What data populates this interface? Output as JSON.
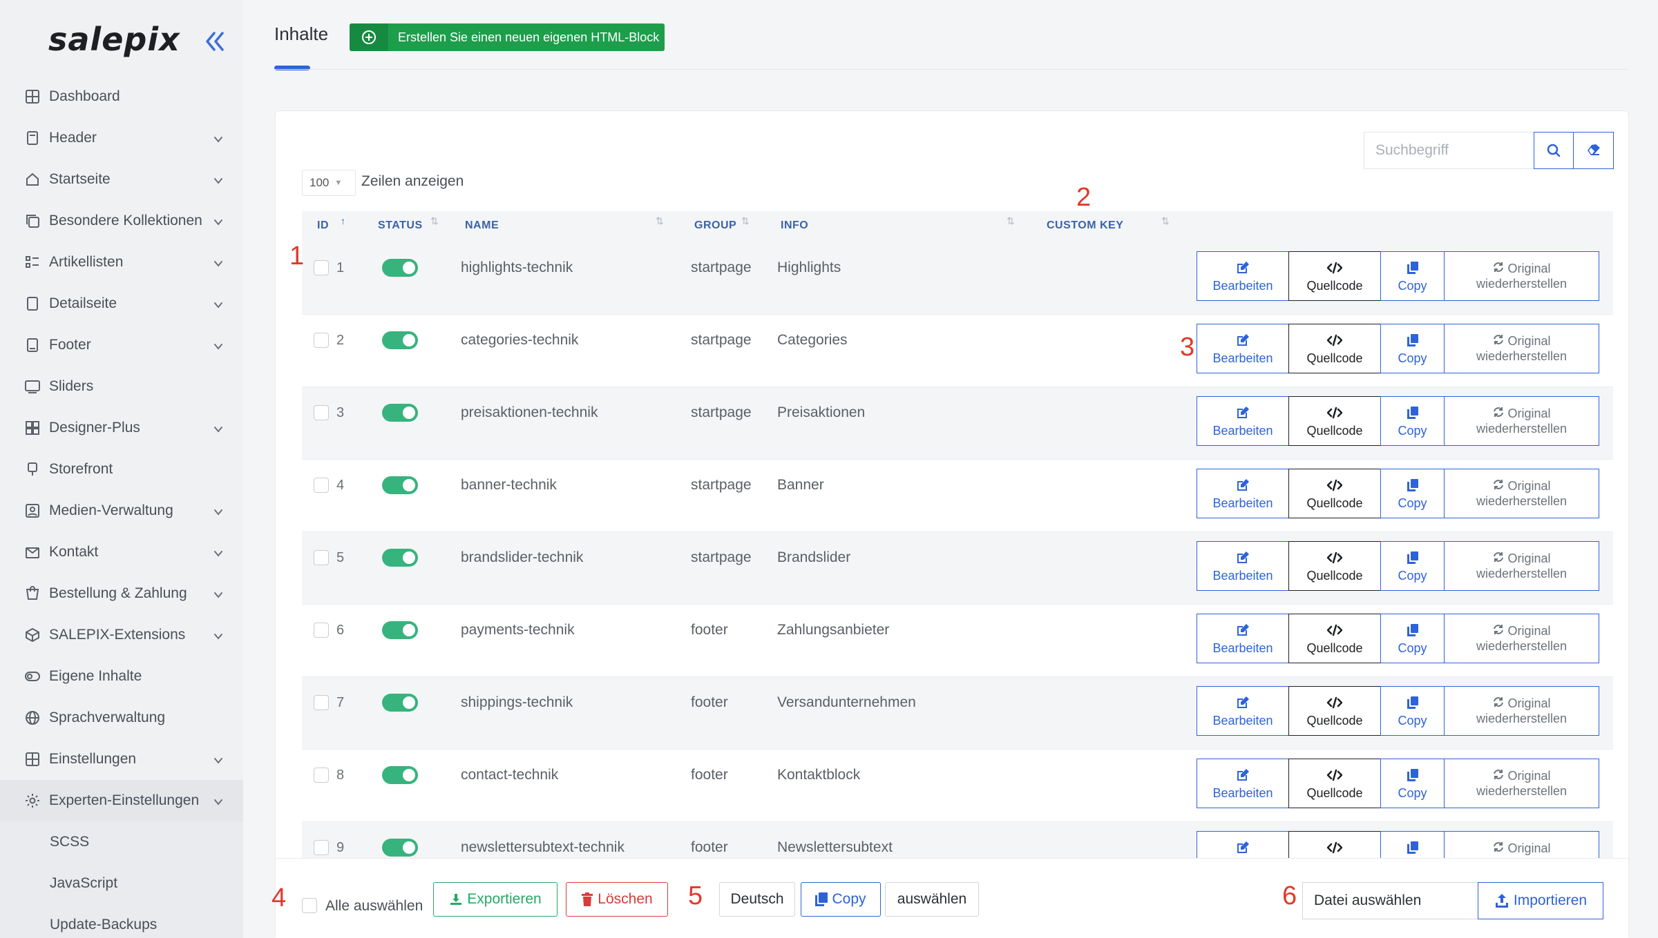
{
  "app": {
    "logo": "salepix"
  },
  "sidebar": {
    "items": [
      {
        "label": "Dashboard",
        "icon": "dashboard-icon",
        "chevron": false
      },
      {
        "label": "Header",
        "icon": "header-icon",
        "chevron": true
      },
      {
        "label": "Startseite",
        "icon": "home-icon",
        "chevron": true
      },
      {
        "label": "Besondere Kollektionen",
        "icon": "collection-icon",
        "chevron": true
      },
      {
        "label": "Artikellisten",
        "icon": "list-icon",
        "chevron": true
      },
      {
        "label": "Detailseite",
        "icon": "page-icon",
        "chevron": true
      },
      {
        "label": "Footer",
        "icon": "footer-icon",
        "chevron": true
      },
      {
        "label": "Sliders",
        "icon": "slider-icon",
        "chevron": false
      },
      {
        "label": "Designer-Plus",
        "icon": "designer-icon",
        "chevron": true
      },
      {
        "label": "Storefront",
        "icon": "storefront-icon",
        "chevron": false
      },
      {
        "label": "Medien-Verwaltung",
        "icon": "media-icon",
        "chevron": true
      },
      {
        "label": "Kontakt",
        "icon": "mail-icon",
        "chevron": true
      },
      {
        "label": "Bestellung & Zahlung",
        "icon": "cart-icon",
        "chevron": true
      },
      {
        "label": "SALEPIX-Extensions",
        "icon": "box-icon",
        "chevron": true
      },
      {
        "label": "Eigene Inhalte",
        "icon": "toggle-icon",
        "chevron": false
      },
      {
        "label": "Sprachverwaltung",
        "icon": "globe-icon",
        "chevron": false
      },
      {
        "label": "Einstellungen",
        "icon": "settings-grid-icon",
        "chevron": true
      },
      {
        "label": "Experten-Einstellungen",
        "icon": "gear-icon",
        "chevron": true
      }
    ],
    "subitems": [
      "SCSS",
      "JavaScript",
      "Update-Backups"
    ]
  },
  "header": {
    "title": "Inhalte",
    "new_button": "Erstellen Sie einen neuen eigenen HTML-Block"
  },
  "search": {
    "placeholder": "Suchbegriff"
  },
  "table": {
    "rows_per_page": "100",
    "rows_label": "Zeilen anzeigen",
    "columns": [
      "ID",
      "STATUS",
      "NAME",
      "GROUP",
      "INFO",
      "CUSTOM KEY"
    ],
    "rows": [
      {
        "id": "1",
        "name": "highlights-technik",
        "group": "startpage",
        "info": "Highlights",
        "active": true
      },
      {
        "id": "2",
        "name": "categories-technik",
        "group": "startpage",
        "info": "Categories",
        "active": true
      },
      {
        "id": "3",
        "name": "preisaktionen-technik",
        "group": "startpage",
        "info": "Preisaktionen",
        "active": true
      },
      {
        "id": "4",
        "name": "banner-technik",
        "group": "startpage",
        "info": "Banner",
        "active": true
      },
      {
        "id": "5",
        "name": "brandslider-technik",
        "group": "startpage",
        "info": "Brandslider",
        "active": true
      },
      {
        "id": "6",
        "name": "payments-technik",
        "group": "footer",
        "info": "Zahlungsanbieter",
        "active": true
      },
      {
        "id": "7",
        "name": "shippings-technik",
        "group": "footer",
        "info": "Versandunternehmen",
        "active": true
      },
      {
        "id": "8",
        "name": "contact-technik",
        "group": "footer",
        "info": "Kontaktblock",
        "active": true
      },
      {
        "id": "9",
        "name": "newslettersubtext-technik",
        "group": "footer",
        "info": "Newslettersubtext",
        "active": true
      }
    ],
    "actions": {
      "edit": "Bearbeiten",
      "source": "Quellcode",
      "copy": "Copy",
      "restore_top": "Original",
      "restore_bottom": "wiederherstellen"
    }
  },
  "footer": {
    "select_all": "Alle auswählen",
    "export": "Exportieren",
    "delete": "Löschen",
    "language": "Deutsch",
    "copy": "Copy",
    "choose": "auswählen",
    "file_input": "Datei auswählen",
    "import": "Importieren"
  },
  "annotations": [
    "1",
    "2",
    "3",
    "4",
    "5",
    "6"
  ],
  "colors": {
    "accent": "#2d63d8",
    "success": "#1c9e4b",
    "danger": "#d93b3b",
    "toggle_on": "#37b37e",
    "annotation": "#e03a2a"
  }
}
